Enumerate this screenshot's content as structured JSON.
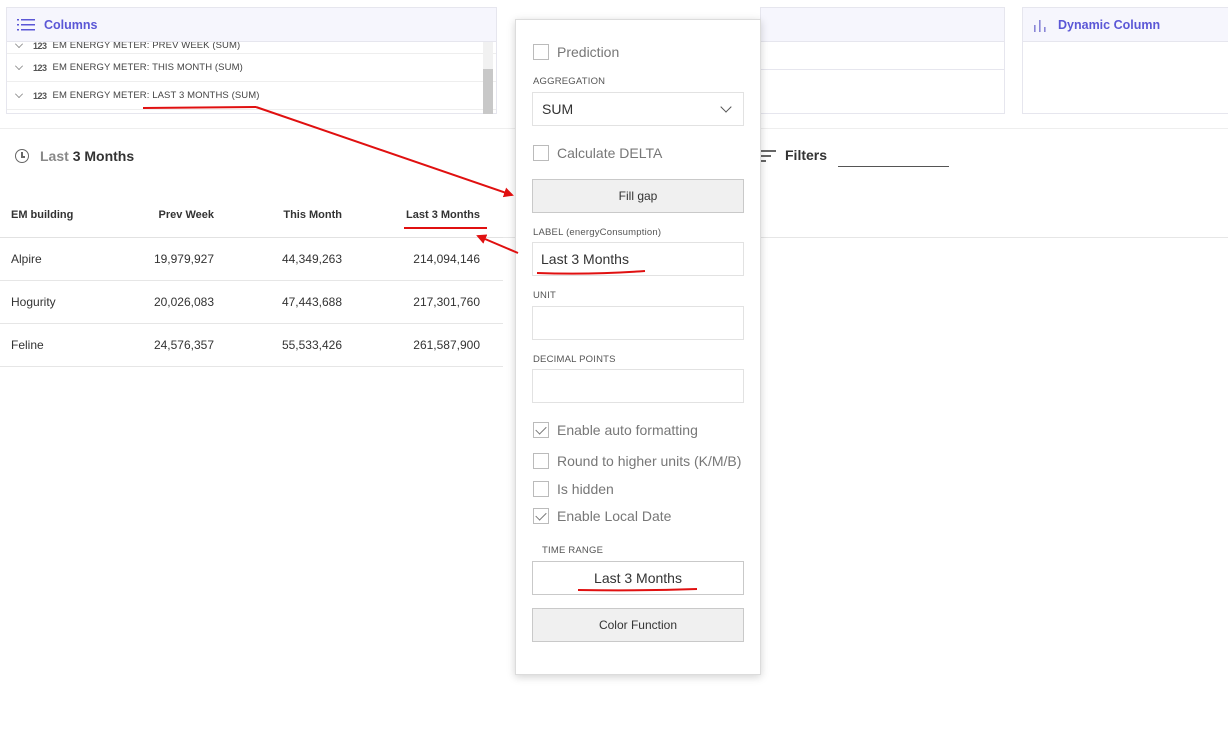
{
  "columns_panel": {
    "title": "Columns",
    "items": [
      {
        "label": "EM ENERGY METER: PREV WEEK (SUM)",
        "type_icon": "123"
      },
      {
        "label": "EM ENERGY METER: THIS MONTH (SUM)",
        "type_icon": "123"
      },
      {
        "label": "EM ENERGY METER: LAST 3 MONTHS (SUM)",
        "type_icon": "123"
      }
    ]
  },
  "dynamic_panel": {
    "title": "Dynamic Column"
  },
  "time_range": {
    "prefix": "Last",
    "value": "3 Months"
  },
  "filters": {
    "label": "Filters"
  },
  "table": {
    "headers": [
      "EM building",
      "Prev Week",
      "This Month",
      "Last 3 Months"
    ],
    "rows": [
      [
        "Alpire",
        "19,979,927",
        "44,349,263",
        "214,094,146"
      ],
      [
        "Hogurity",
        "20,026,083",
        "47,443,688",
        "217,301,760"
      ],
      [
        "Feline",
        "24,576,357",
        "55,533,426",
        "261,587,900"
      ]
    ]
  },
  "editor": {
    "prediction_label": "Prediction",
    "prediction_checked": false,
    "aggregation_label": "AGGREGATION",
    "aggregation_value": "SUM",
    "calc_delta_label": "Calculate DELTA",
    "calc_delta_checked": false,
    "fill_gap_label": "Fill gap",
    "label_label": "LABEL (energyConsumption)",
    "label_value": "Last 3 Months",
    "unit_label": "UNIT",
    "unit_value": "",
    "decimal_label": "DECIMAL POINTS",
    "decimal_value": "",
    "auto_format_label": "Enable auto formatting",
    "auto_format_checked": true,
    "round_label": "Round to higher units (K/M/B)",
    "round_checked": false,
    "hidden_label": "Is hidden",
    "hidden_checked": false,
    "local_date_label": "Enable Local Date",
    "local_date_checked": true,
    "time_range_label": "TIME RANGE",
    "time_range_value": "Last 3 Months",
    "color_function_label": "Color Function"
  },
  "annotation_color": "#e01010",
  "accent_color": "#5b57d6"
}
